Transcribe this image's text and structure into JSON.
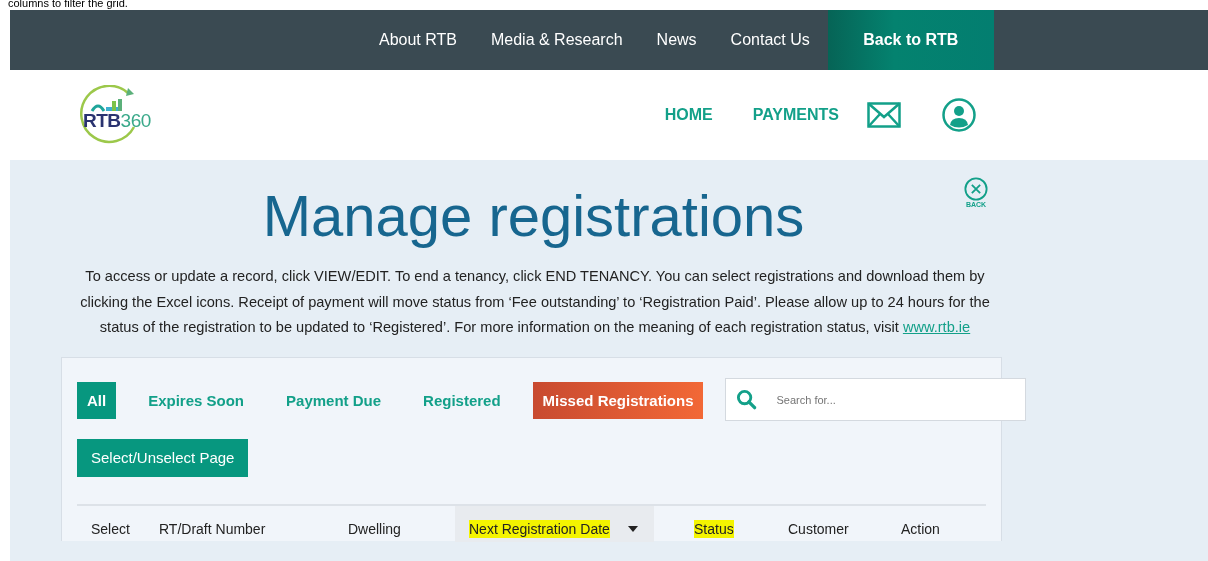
{
  "document_text": "columns to filter the grid.",
  "top_nav": {
    "links": [
      "About RTB",
      "Media & Research",
      "News",
      "Contact Us"
    ],
    "button": "Back to RTB"
  },
  "header": {
    "logo": {
      "primary": "RTB",
      "secondary": "360"
    },
    "links": [
      "HOME",
      "PAYMENTS"
    ]
  },
  "back_label": "BACK",
  "title": "Manage registrations",
  "intro": {
    "text": "To access or update a record, click VIEW/EDIT. To end a tenancy, click END TENANCY. You can select registrations and download them by clicking the Excel icons. Receipt of payment will move status from ‘Fee outstanding’ to ‘Registration Paid’. Please allow up to 24 hours for the status of the registration to be updated to ‘Registered’. For more information on the meaning of each registration status, visit ",
    "link": "www.rtb.ie"
  },
  "filters": [
    {
      "label": "All",
      "selected": true,
      "kind": "tab"
    },
    {
      "label": "Expires Soon",
      "selected": false,
      "kind": "tab"
    },
    {
      "label": "Payment Due",
      "selected": false,
      "kind": "tab"
    },
    {
      "label": "Registered",
      "selected": false,
      "kind": "tab"
    },
    {
      "label": "Missed Registrations",
      "selected": false,
      "kind": "alert"
    }
  ],
  "search": {
    "placeholder": "Search for..."
  },
  "select_page_button": "Select/Unselect Page",
  "columns": [
    {
      "label": "Select",
      "sorted": false,
      "highlighted": false
    },
    {
      "label": "RT/Draft Number",
      "sorted": false,
      "highlighted": false
    },
    {
      "label": "Dwelling",
      "sorted": false,
      "highlighted": false
    },
    {
      "label": "Next Registration Date",
      "sorted": true,
      "highlighted": true
    },
    {
      "label": "Status",
      "sorted": false,
      "highlighted": true
    },
    {
      "label": "Customer",
      "sorted": false,
      "highlighted": false
    },
    {
      "label": "Action",
      "sorted": false,
      "highlighted": false
    }
  ]
}
